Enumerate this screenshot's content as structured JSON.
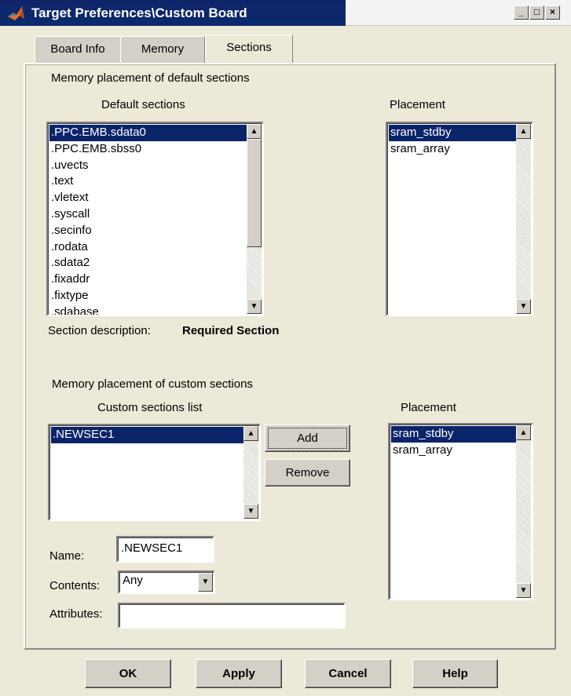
{
  "window": {
    "title": "Target Preferences\\Custom Board",
    "controls": {
      "minimize": "_",
      "maximize": "□",
      "close": "×"
    }
  },
  "tabs": [
    {
      "label": "Board Info",
      "active": false
    },
    {
      "label": "Memory",
      "active": false
    },
    {
      "label": "Sections",
      "active": true
    }
  ],
  "default_sections": {
    "group_title": "Memory placement of default sections",
    "list_title": "Default sections",
    "items": [
      ".PPC.EMB.sdata0",
      ".PPC.EMB.sbss0",
      ".uvects",
      ".text",
      ".vletext",
      ".syscall",
      ".secinfo",
      ".rodata",
      ".sdata2",
      ".fixaddr",
      ".fixtype",
      ".sdabase"
    ],
    "selected_index": 0,
    "placement_title": "Placement",
    "placement_items": [
      "sram_stdby",
      "sram_array"
    ],
    "placement_selected_index": 0,
    "description_label": "Section description:",
    "description_value": "Required Section"
  },
  "custom_sections": {
    "group_title": "Memory placement of custom sections",
    "list_title": "Custom sections list",
    "items": [
      ".NEWSEC1"
    ],
    "selected_index": 0,
    "add_label": "Add",
    "remove_label": "Remove",
    "placement_title": "Placement",
    "placement_items": [
      "sram_stdby",
      "sram_array"
    ],
    "placement_selected_index": 0,
    "name_label": "Name:",
    "name_value": ".NEWSEC1",
    "contents_label": "Contents:",
    "contents_value": "Any",
    "attributes_label": "Attributes:",
    "attributes_value": ""
  },
  "footer": {
    "ok": "OK",
    "apply": "Apply",
    "cancel": "Cancel",
    "help": "Help"
  },
  "colors": {
    "selection": "#0a246a",
    "title_bar": "#0a246a",
    "dialog_bg": "#ece9d8"
  }
}
